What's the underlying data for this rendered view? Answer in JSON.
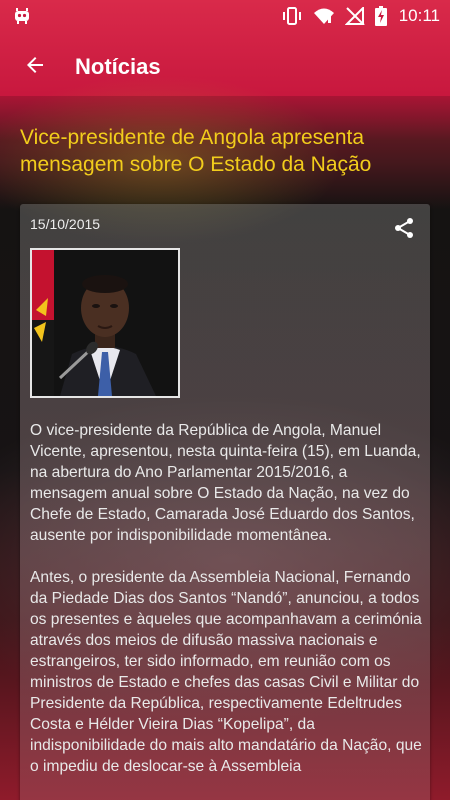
{
  "status_bar": {
    "time": "10:11",
    "icons": [
      "android-debug-icon",
      "vibrate-icon",
      "wifi-icon",
      "no-sim-icon",
      "battery-charging-icon"
    ]
  },
  "app_bar": {
    "title": "Notícias",
    "back_icon": "arrow-back-icon"
  },
  "article": {
    "headline": "Vice-presidente de Angola apresenta mensagem sobre O Estado da Nação",
    "date": "15/10/2015",
    "share_icon": "share-icon",
    "photo_icon": "person-photo-icon",
    "paragraphs": [
      "O vice-presidente da República de Angola, Manuel Vicente, apresentou, nesta quinta-feira (15), em Luanda, na abertura do Ano Parlamentar 2015/2016, a mensagem anual sobre O Estado da Nação, na vez do Chefe de Estado, Camarada José Eduardo dos Santos, ausente por indisponibilidade momentânea.",
      "Antes, o presidente da Assembleia Nacional, Fernando da Piedade Dias dos Santos “Nandó”, anunciou, a todos os presentes e àqueles que acompanhavam a cerimónia através dos meios de difusão massiva nacionais e estrangeiros, ter sido informado, em reunião com os ministros de Estado e chefes das casas Civil e Militar do Presidente da República, respectivamente Edeltrudes Costa e Hélder Vieira Dias “Kopelipa”, da indisponibilidade do mais alto mandatário da Nação, que o impediu de deslocar-se à Assembleia"
    ]
  },
  "colors": {
    "headline": "#f2cd1c",
    "flag_red": "#c8183e",
    "flag_black": "#151312",
    "text": "#e9e9e9"
  }
}
